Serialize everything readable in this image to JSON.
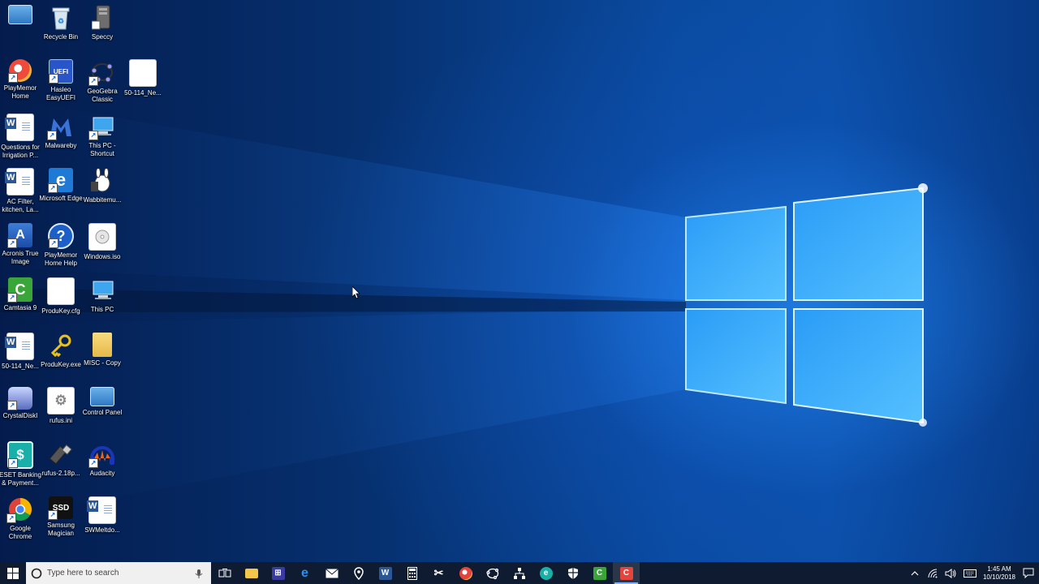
{
  "desktop": {
    "icons": [
      {
        "label": "",
        "icon": "control-panel-icon"
      },
      {
        "label": "Recycle Bin",
        "icon": "recycle-bin-icon"
      },
      {
        "label": "Speccy",
        "icon": "speccy-icon"
      },
      {
        "label": "PlayMemor Home",
        "icon": "playmemories-icon"
      },
      {
        "label": "Hasleo EasyUEFI",
        "icon": "easyuefi-icon"
      },
      {
        "label": "GeoGebra Classic",
        "icon": "geogebra-icon"
      },
      {
        "label": "50-114_Ne...",
        "icon": "pdf-document-icon"
      },
      {
        "label": "Questions for Irrigation P...",
        "icon": "word-document-icon"
      },
      {
        "label": "Malwareby",
        "icon": "malwarebytes-icon"
      },
      {
        "label": "This PC - Shortcut",
        "icon": "this-pc-icon"
      },
      {
        "label": "AC Filter, kitchen, La...",
        "icon": "word-document-icon"
      },
      {
        "label": "Microsoft Edge",
        "icon": "edge-icon"
      },
      {
        "label": "Wabbitemu...",
        "icon": "wabbitemu-icon"
      },
      {
        "label": "Acronis True Image",
        "icon": "acronis-icon"
      },
      {
        "label": "PlayMemor Home Help",
        "icon": "help-icon"
      },
      {
        "label": "Windows.iso",
        "icon": "disc-image-icon"
      },
      {
        "label": "Camtasia 9",
        "icon": "camtasia-icon"
      },
      {
        "label": "ProduKey.cfg",
        "icon": "file-icon"
      },
      {
        "label": "This PC",
        "icon": "this-pc-icon"
      },
      {
        "label": "50-114_Ne...",
        "icon": "word-document-icon"
      },
      {
        "label": "ProduKey.exe",
        "icon": "key-icon"
      },
      {
        "label": "MISC - Copy",
        "icon": "folder-icon"
      },
      {
        "label": "CrystalDiskI",
        "icon": "crystaldisk-icon"
      },
      {
        "label": "rufus.ini",
        "icon": "settings-file-icon"
      },
      {
        "label": "Control Panel",
        "icon": "control-panel-icon"
      },
      {
        "label": "ESET Banking & Payment...",
        "icon": "eset-icon"
      },
      {
        "label": "rufus-2.18p...",
        "icon": "usb-icon"
      },
      {
        "label": "Audacity",
        "icon": "audacity-icon"
      },
      {
        "label": "Google Chrome",
        "icon": "chrome-icon"
      },
      {
        "label": "Samsung Magician",
        "icon": "samsung-ssd-icon"
      },
      {
        "label": "SWMeltdo...",
        "icon": "word-document-icon"
      }
    ]
  },
  "taskbar": {
    "search_placeholder": "Type here to search",
    "apps": [
      {
        "name": "task-view",
        "color": "#ffffff"
      },
      {
        "name": "file-explorer",
        "color": "#f6c64a"
      },
      {
        "name": "store",
        "color": "#3b3b9f"
      },
      {
        "name": "edge",
        "color": "#1f7ad6"
      },
      {
        "name": "mail",
        "color": "#ffffff"
      },
      {
        "name": "maps",
        "color": "#ffffff"
      },
      {
        "name": "word",
        "color": "#2b5797"
      },
      {
        "name": "calculator",
        "color": "#ffffff"
      },
      {
        "name": "snipping-tool",
        "color": "#ffffff"
      },
      {
        "name": "playmemories",
        "color": "#e2453c"
      },
      {
        "name": "geogebra",
        "color": "#ffffff"
      },
      {
        "name": "network-tool",
        "color": "#ffffff"
      },
      {
        "name": "eset",
        "color": "#18b0a8"
      },
      {
        "name": "security",
        "color": "#ffffff"
      },
      {
        "name": "camtasia",
        "color": "#3aa63a"
      },
      {
        "name": "camtasia-recorder",
        "color": "#e2453c"
      }
    ],
    "clock_time": "1:45 AM",
    "clock_date": "10/10/2018"
  }
}
